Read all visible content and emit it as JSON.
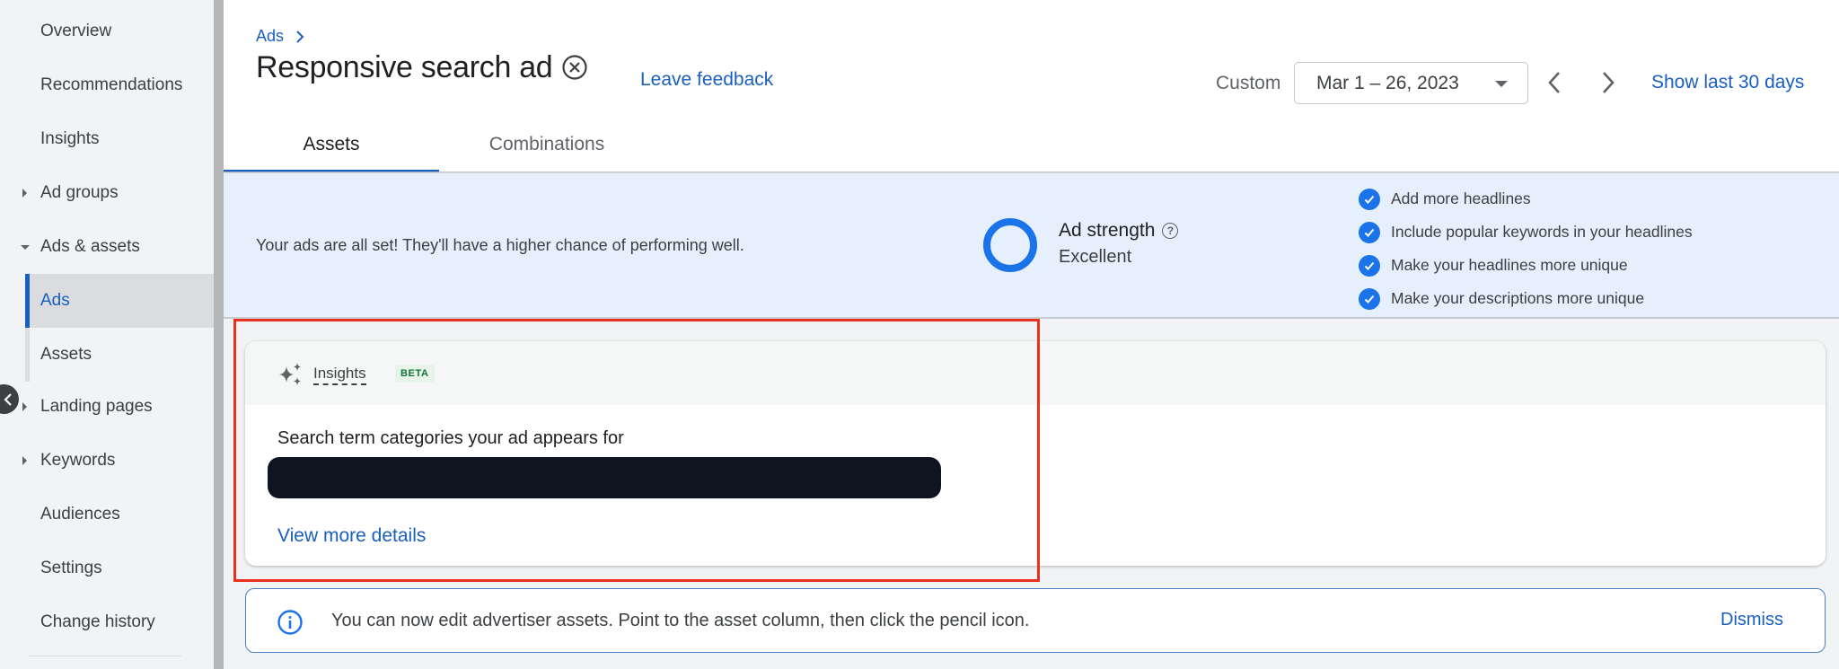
{
  "sidebar": {
    "items": [
      {
        "label": "Overview"
      },
      {
        "label": "Recommendations"
      },
      {
        "label": "Insights"
      },
      {
        "label": "Ad groups",
        "expandable": true
      },
      {
        "label": "Ads & assets",
        "expanded": true
      },
      {
        "label": "Ads",
        "active": true
      },
      {
        "label": "Assets"
      },
      {
        "label": "Landing pages",
        "expandable": true
      },
      {
        "label": "Keywords",
        "expandable": true
      },
      {
        "label": "Audiences"
      },
      {
        "label": "Settings"
      },
      {
        "label": "Change history"
      }
    ],
    "collapse_icon": "chevron-left-icon"
  },
  "header": {
    "breadcrumb": "Ads",
    "title": "Responsive search ad",
    "feedback_link": "Leave feedback",
    "date_label": "Custom",
    "date_range": "Mar 1 – 26, 2023",
    "show_last": "Show last 30 days",
    "tabs": [
      {
        "label": "Assets",
        "active": true
      },
      {
        "label": "Combinations",
        "active": false
      }
    ]
  },
  "strength": {
    "message": "Your ads are all set! They'll have a higher chance of performing well.",
    "title": "Ad strength",
    "value": "Excellent",
    "help_glyph": "?",
    "checklist": [
      "Add more headlines",
      "Include popular keywords in your headlines",
      "Make your headlines more unique",
      "Make your descriptions more unique"
    ]
  },
  "insights": {
    "label": "Insights",
    "badge": "BETA",
    "subtitle": "Search term categories your ad appears for",
    "link": "View more details"
  },
  "banner": {
    "text": "You can now edit advertiser assets. Point to the asset column, then click the pencil icon.",
    "dismiss": "Dismiss"
  },
  "colors": {
    "accent": "#1a5fbf",
    "ring": "#1a73e8",
    "highlight": "#e8321f",
    "strength_bg": "#e6effc",
    "beta_bg": "#e6f4ea",
    "beta_fg": "#137333"
  }
}
